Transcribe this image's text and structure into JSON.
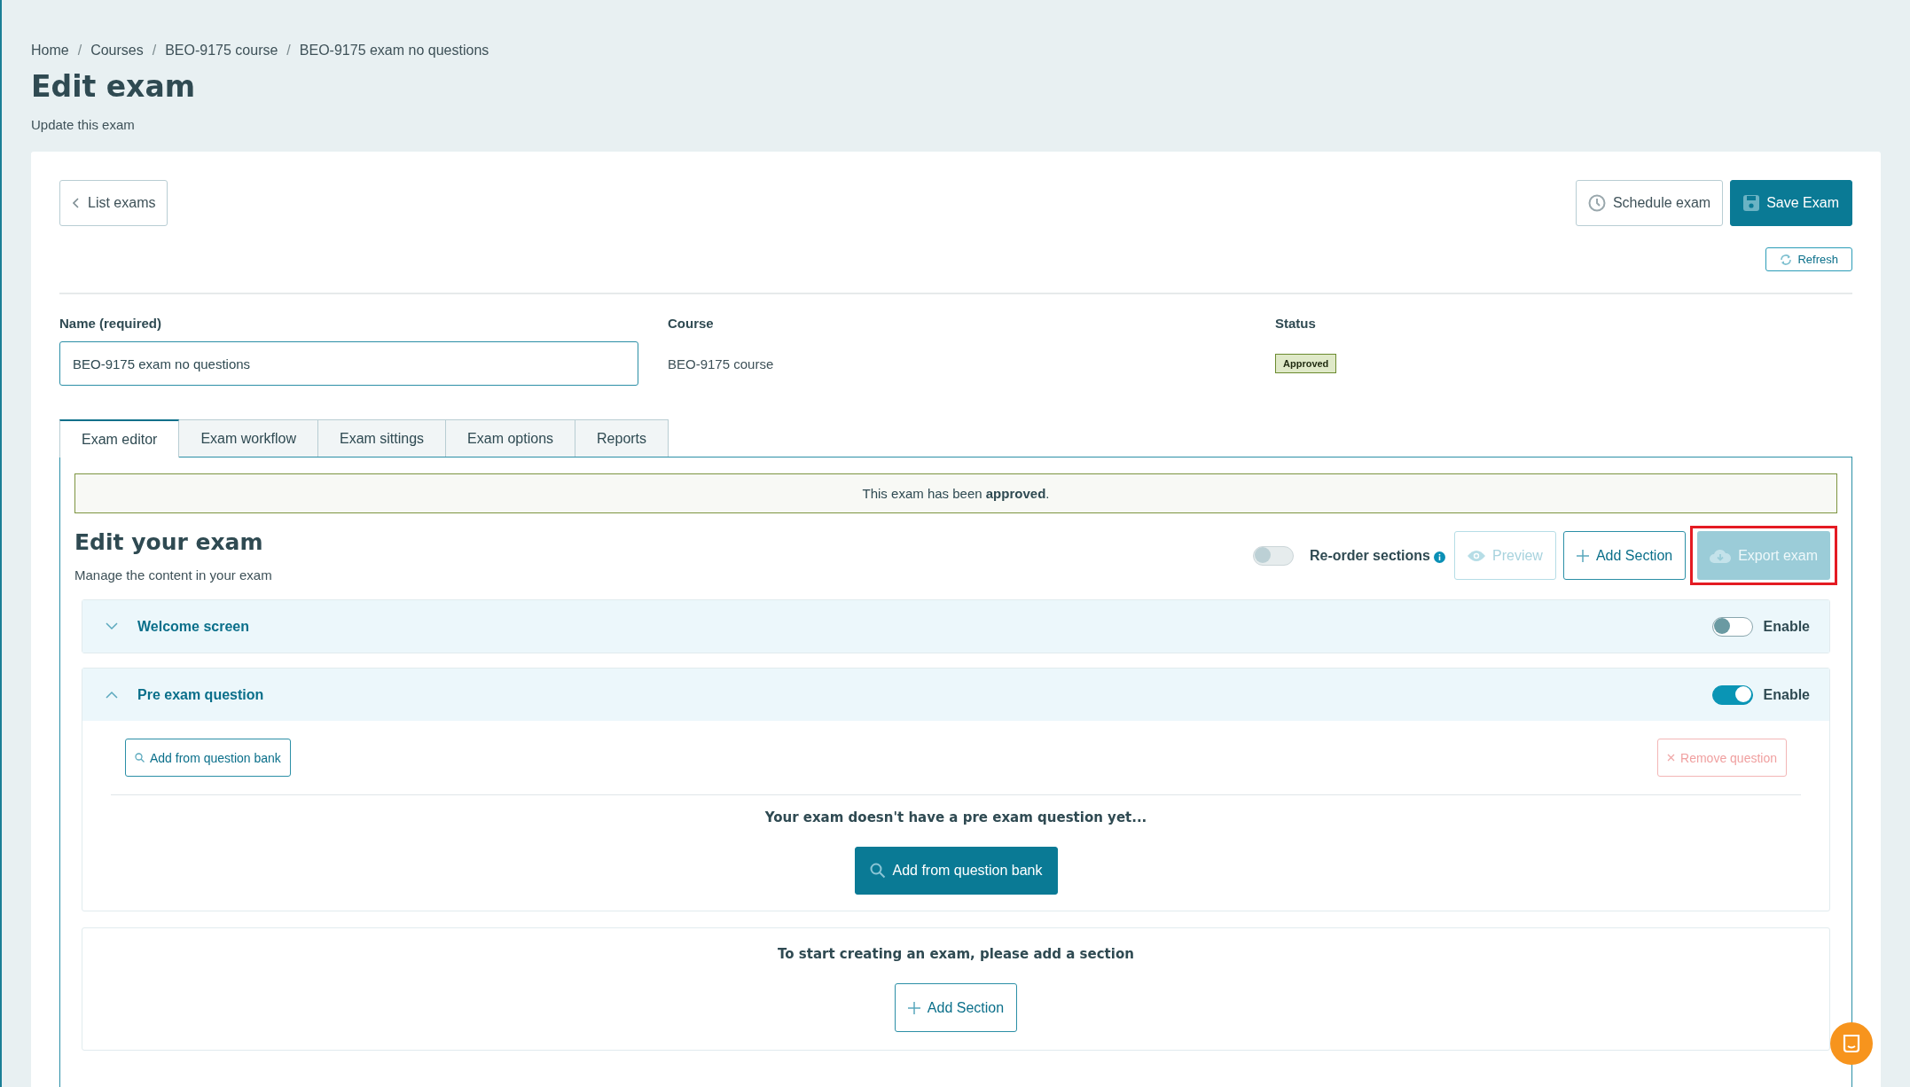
{
  "breadcrumb": [
    {
      "label": "Home",
      "link": true
    },
    {
      "separator": "/",
      "label": "Courses",
      "link": true
    },
    {
      "separator": "/",
      "label": "BEO-9175 course",
      "link": true
    },
    {
      "separator": "/",
      "label": "BEO-9175 exam no questions",
      "link": false
    }
  ],
  "page": {
    "title": "Edit exam",
    "subtitle": "Update this exam"
  },
  "toolbar": {
    "back": "List exams",
    "schedule": "Schedule exam",
    "save": "Save Exam",
    "refresh": "Refresh"
  },
  "fields": {
    "name_label": "Name (required)",
    "name_value": "BEO-9175 exam no questions",
    "course_label": "Course",
    "course_value": "BEO-9175 course",
    "status_label": "Status",
    "status_badge": "Approved"
  },
  "tabs": [
    {
      "label": "Exam editor",
      "selected": true
    },
    {
      "label": "Exam workflow",
      "selected": false
    },
    {
      "label": "Exam sittings",
      "selected": false
    },
    {
      "label": "Exam options",
      "selected": false
    },
    {
      "label": "Reports",
      "selected": false
    }
  ],
  "banner": "This exam has been **approved**.",
  "editor": {
    "title": "Edit your exam",
    "subtitle": "Manage the content in your exam",
    "reorder": {
      "label": "Re-order sections",
      "on": false,
      "disabled": true
    },
    "buttons": [
      {
        "kind": "preview",
        "label": "Preview",
        "disabled": true,
        "highlighted": false
      },
      {
        "kind": "add",
        "label": "Add Section",
        "disabled": false,
        "highlighted": false
      },
      {
        "kind": "export",
        "label": "Export exam",
        "disabled": true,
        "highlighted": true
      }
    ]
  },
  "sections": [
    {
      "title": "Welcome screen",
      "expanded": false,
      "enabled": false,
      "toggle_label": "Enable"
    },
    {
      "title": "Pre exam question",
      "expanded": true,
      "enabled": true,
      "toggle_label": "Enable",
      "add_button": "Add from question bank",
      "remove_button": {
        "label": "Remove question",
        "disabled": true
      },
      "empty_text": "Your exam doesn't have a pre exam question yet...",
      "primary_button": "Add from question bank"
    }
  ],
  "add_section_card": {
    "text": "To start creating an exam, please **add a section**",
    "button": "Add Section"
  }
}
